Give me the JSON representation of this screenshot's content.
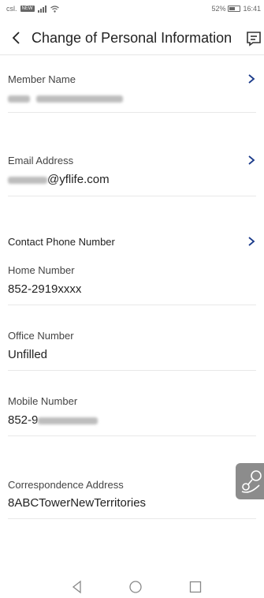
{
  "status": {
    "carrier": "csl.",
    "carrier_badge": "NEW",
    "battery": "52%",
    "battery_level": 0.52,
    "time": "16:41"
  },
  "header": {
    "title": "Change of Personal Information"
  },
  "fields": {
    "member_name": {
      "label": "Member Name"
    },
    "email": {
      "label": "Email Address",
      "value_suffix": "@yflife.com"
    },
    "contact_phone": {
      "label": "Contact Phone Number"
    },
    "home_number": {
      "label": "Home Number",
      "value": "852-2919xxxx"
    },
    "office_number": {
      "label": "Office Number",
      "value": "Unfilled"
    },
    "mobile_number": {
      "label": "Mobile Number",
      "value_prefix": "852-9"
    },
    "correspondence_address": {
      "label": "Correspondence Address",
      "value": "8ABCTowerNewTerritories"
    }
  }
}
